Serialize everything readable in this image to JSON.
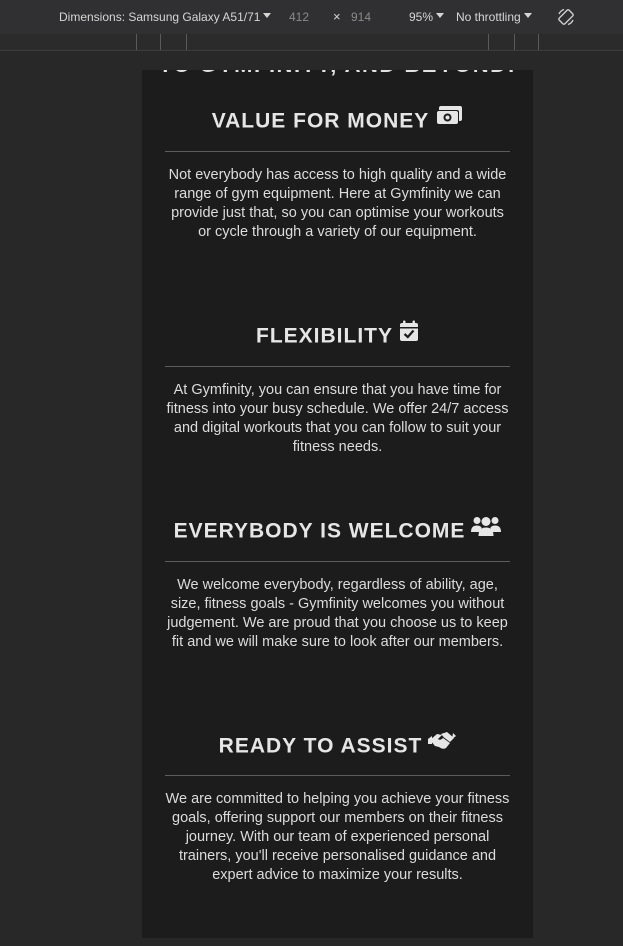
{
  "devtools": {
    "dimensions_label": "Dimensions: Samsung Galaxy A51/71",
    "width": "412",
    "times": "×",
    "height": "914",
    "zoom": "95%",
    "throttling": "No throttling",
    "rotate_icon": "rotate-icon"
  },
  "page": {
    "clipped_heading": "TO GYMFINITY, AND BEYOND!",
    "sections": [
      {
        "title": "VALUE FOR MONEY",
        "icon": "money-bill-icon",
        "body": "Not everybody has access to high quality and a wide range of gym equipment. Here at Gymfinity we can provide just that, so you can optimise your workouts or cycle through a variety of our equipment."
      },
      {
        "title": "FLEXIBILITY",
        "icon": "calendar-check-icon",
        "body": "At Gymfinity, you can ensure that you have time for fitness into your busy schedule. We offer 24/7 access and digital workouts that you can follow to suit your fitness needs."
      },
      {
        "title": "EVERYBODY IS WELCOME",
        "icon": "users-icon",
        "body": "We welcome everybody, regardless of ability, age, size, fitness goals - Gymfinity welcomes you without judgement. We are proud that you choose us to keep fit and we will make sure to look after our members."
      },
      {
        "title": "READY TO ASSIST",
        "icon": "handshake-icon",
        "body": "We are committed to helping you achieve your fitness goals, offering support our members on their fitness journey. With our team of experienced personal trainers, you'll receive personalised guidance and expert advice to maximize your results."
      }
    ]
  }
}
